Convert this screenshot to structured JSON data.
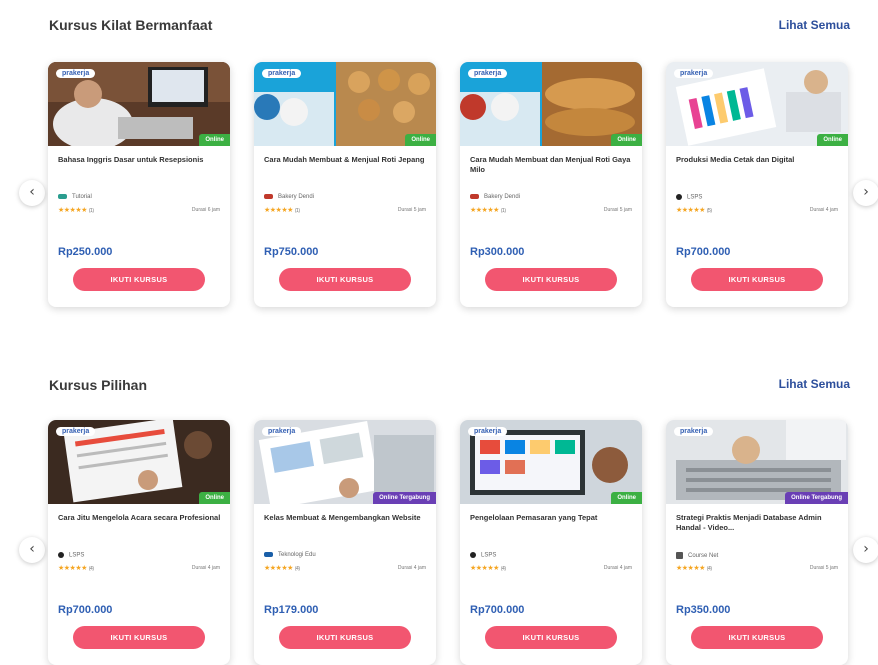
{
  "sections": [
    {
      "title": "Kursus Kilat Bermanfaat",
      "see_all": "Lihat Semua",
      "cards": [
        {
          "logo": "prakerja",
          "badge": "Online",
          "badge_color": "#3cb043",
          "title": "Bahasa Inggris Dasar untuk Resepsionis",
          "provider": "Tutorial",
          "stars": "★★★★★",
          "rating_count": "(1)",
          "duration": "Durasi 6 jam",
          "price": "Rp250.000",
          "button": "IKUTI KURSUS"
        },
        {
          "logo": "prakerja",
          "badge": "Online",
          "badge_color": "#3cb043",
          "title": "Cara Mudah Membuat & Menjual Roti Jepang",
          "provider": "Bakery Dendi",
          "stars": "★★★★★",
          "rating_count": "(1)",
          "duration": "Durasi 5 jam",
          "price": "Rp750.000",
          "button": "IKUTI KURSUS"
        },
        {
          "logo": "prakerja",
          "badge": "Online",
          "badge_color": "#3cb043",
          "title": "Cara Mudah Membuat dan Menjual Roti Gaya Milo",
          "provider": "Bakery Dendi",
          "stars": "★★★★★",
          "rating_count": "(1)",
          "duration": "Durasi 5 jam",
          "price": "Rp300.000",
          "button": "IKUTI KURSUS"
        },
        {
          "logo": "prakerja",
          "badge": "Online",
          "badge_color": "#3cb043",
          "title": "Produksi Media Cetak dan Digital",
          "provider": "LSPS",
          "stars": "★★★★★",
          "rating_count": "(5)",
          "duration": "Durasi 4 jam",
          "price": "Rp700.000",
          "button": "IKUTI KURSUS"
        }
      ]
    },
    {
      "title": "Kursus Pilihan",
      "see_all": "Lihat Semua",
      "cards": [
        {
          "logo": "prakerja",
          "badge": "Online",
          "badge_color": "#3cb043",
          "title": "Cara Jitu Mengelola Acara secara Profesional",
          "provider": "LSPS",
          "stars": "★★★★★",
          "rating_count": "(4)",
          "duration": "Durasi 4 jam",
          "price": "Rp700.000",
          "button": "IKUTI KURSUS"
        },
        {
          "logo": "prakerja",
          "badge": "Online Tergabung",
          "badge_color": "#6a3fb5",
          "title": "Kelas Membuat & Mengembangkan Website",
          "provider": "Teknologi Edu",
          "stars": "★★★★★",
          "rating_count": "(4)",
          "duration": "Durasi 4 jam",
          "price": "Rp179.000",
          "button": "IKUTI KURSUS"
        },
        {
          "logo": "prakerja",
          "badge": "Online",
          "badge_color": "#3cb043",
          "title": "Pengelolaan Pemasaran yang Tepat",
          "provider": "LSPS",
          "stars": "★★★★★",
          "rating_count": "(4)",
          "duration": "Durasi 4 jam",
          "price": "Rp700.000",
          "button": "IKUTI KURSUS"
        },
        {
          "logo": "prakerja",
          "badge": "Online Tergabung",
          "badge_color": "#6a3fb5",
          "title": "Strategi Praktis Menjadi Database Admin Handal - Video...",
          "provider": "Course Net",
          "stars": "★★★★★",
          "rating_count": "(4)",
          "duration": "Durasi 5 jam",
          "price": "Rp350.000",
          "button": "IKUTI KURSUS"
        }
      ]
    }
  ],
  "icons": {
    "prev": "chevron-left-icon",
    "next": "chevron-right-icon"
  },
  "colors": {
    "accent": "#f25670",
    "price": "#2f5fb3",
    "link": "#2d4f9c",
    "star": "#f5a623"
  }
}
